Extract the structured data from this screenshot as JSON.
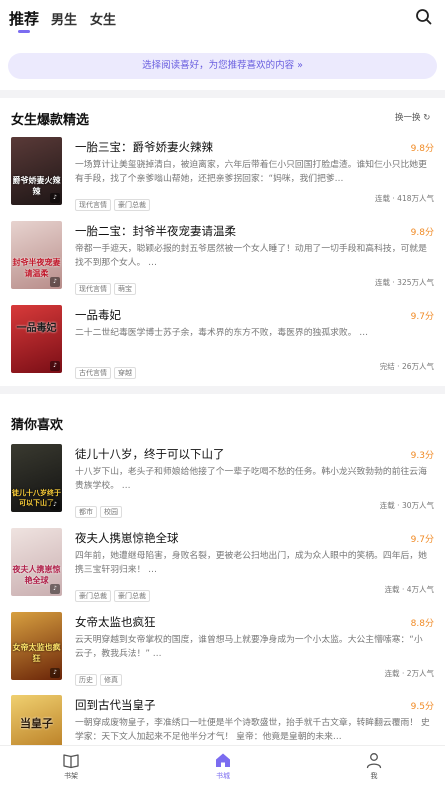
{
  "top_tabs": [
    "推荐",
    "男生",
    "女生"
  ],
  "banner_text": "选择阅读喜好，为您推荐喜欢的内容 »",
  "section1": {
    "title": "女生爆款精选",
    "refresh_label": "换一换",
    "books": [
      {
        "title": "一胎三宝：爵爷娇妻火辣辣",
        "score": "9.8分",
        "desc": "一场算计让美玺骁掉清白，被迫离家，六年后带着仨小只回国打脸虐渣。谁知仨小只比她更有手段，找了个亲爹嗡山帮她，还把亲爹拐回家：“妈咪，我们把爹…",
        "tags": [
          "现代言情",
          "豪门总裁"
        ],
        "meta": "连载 · 418万人气",
        "cover_text": "爵爷娇妻火辣辣",
        "cover_color": "#3a2a2a"
      },
      {
        "title": "一胎二宝：封爷半夜宠妻请温柔",
        "score": "9.8分",
        "desc": "帝都一手遮天，聪颖必报的封五爷居然被一个女人睡了！动用了一切手段和高科技，可就是找不到那个女人。 …",
        "tags": [
          "现代言情",
          "萌宝"
        ],
        "meta": "连载 · 325万人气",
        "cover_text": "封爷半夜宠妻请温柔",
        "cover_color": "#c9a9a6"
      },
      {
        "title": "一品毒妃",
        "score": "9.7分",
        "desc": "二十二世纪毒医学博士苏子余，毒术界的东方不败，毒医界的独孤求败。 …",
        "tags": [
          "古代言情",
          "穿越"
        ],
        "meta": "完结 · 26万人气",
        "cover_text": "一品毒妃",
        "cover_color": "#b8202a"
      }
    ]
  },
  "section2": {
    "title": "猜你喜欢",
    "books": [
      {
        "title": "徒儿十八岁，终于可以下山了",
        "score": "9.3分",
        "desc": "十八岁下山，老头子和师娘给他接了个一辈子吃喝不愁的任务。韩小龙兴致勃勃的前往云海贵族学校。 …",
        "tags": [
          "都市",
          "校园"
        ],
        "meta": "连载 · 30万人气",
        "cover_text": "徒儿十八岁终于可以下山了",
        "cover_color": "#2a2a28"
      },
      {
        "title": "夜夫人携崽惊艳全球",
        "score": "9.7分",
        "desc": "四年前，她遭继母陷害，身败名裂，更被老公扫地出门，成为众人眼中的笑柄。四年后，她携三宝轩羽归来！ …",
        "tags": [
          "豪门总裁",
          "豪门总裁"
        ],
        "meta": "连载 · 4万人气",
        "cover_text": "夜夫人携崽惊艳全球",
        "cover_color": "#d9c7c4"
      },
      {
        "title": "女帝太监也疯狂",
        "score": "8.8分",
        "desc": "云天明穿越到女帝掌权的国度，谁曾想马上就要净身成为一个小太监。大公主懵嗦寒：“小云子，教我兵法！” …",
        "tags": [
          "历史",
          "修真"
        ],
        "meta": "连载 · 2万人气",
        "cover_text": "女帝太监也疯狂",
        "cover_color": "#8a3a18"
      },
      {
        "title": "回到古代当皇子",
        "score": "9.5分",
        "desc": "一朝穿成废物皇子，李准绣口一吐便是半个诗歌盛世，抬手就千古文章，转眸翻云覆雨！ 史学家：天下文人加起来不足他半分才气！ 皇帝：他竟是皇朝的未来…",
        "tags": [],
        "meta": "",
        "cover_text": "当皇子",
        "cover_color": "#e0b040"
      }
    ]
  },
  "bottom_nav": [
    "书架",
    "书城",
    "我"
  ],
  "accent_color": "#7b6cf0",
  "score_color": "#f08a24"
}
